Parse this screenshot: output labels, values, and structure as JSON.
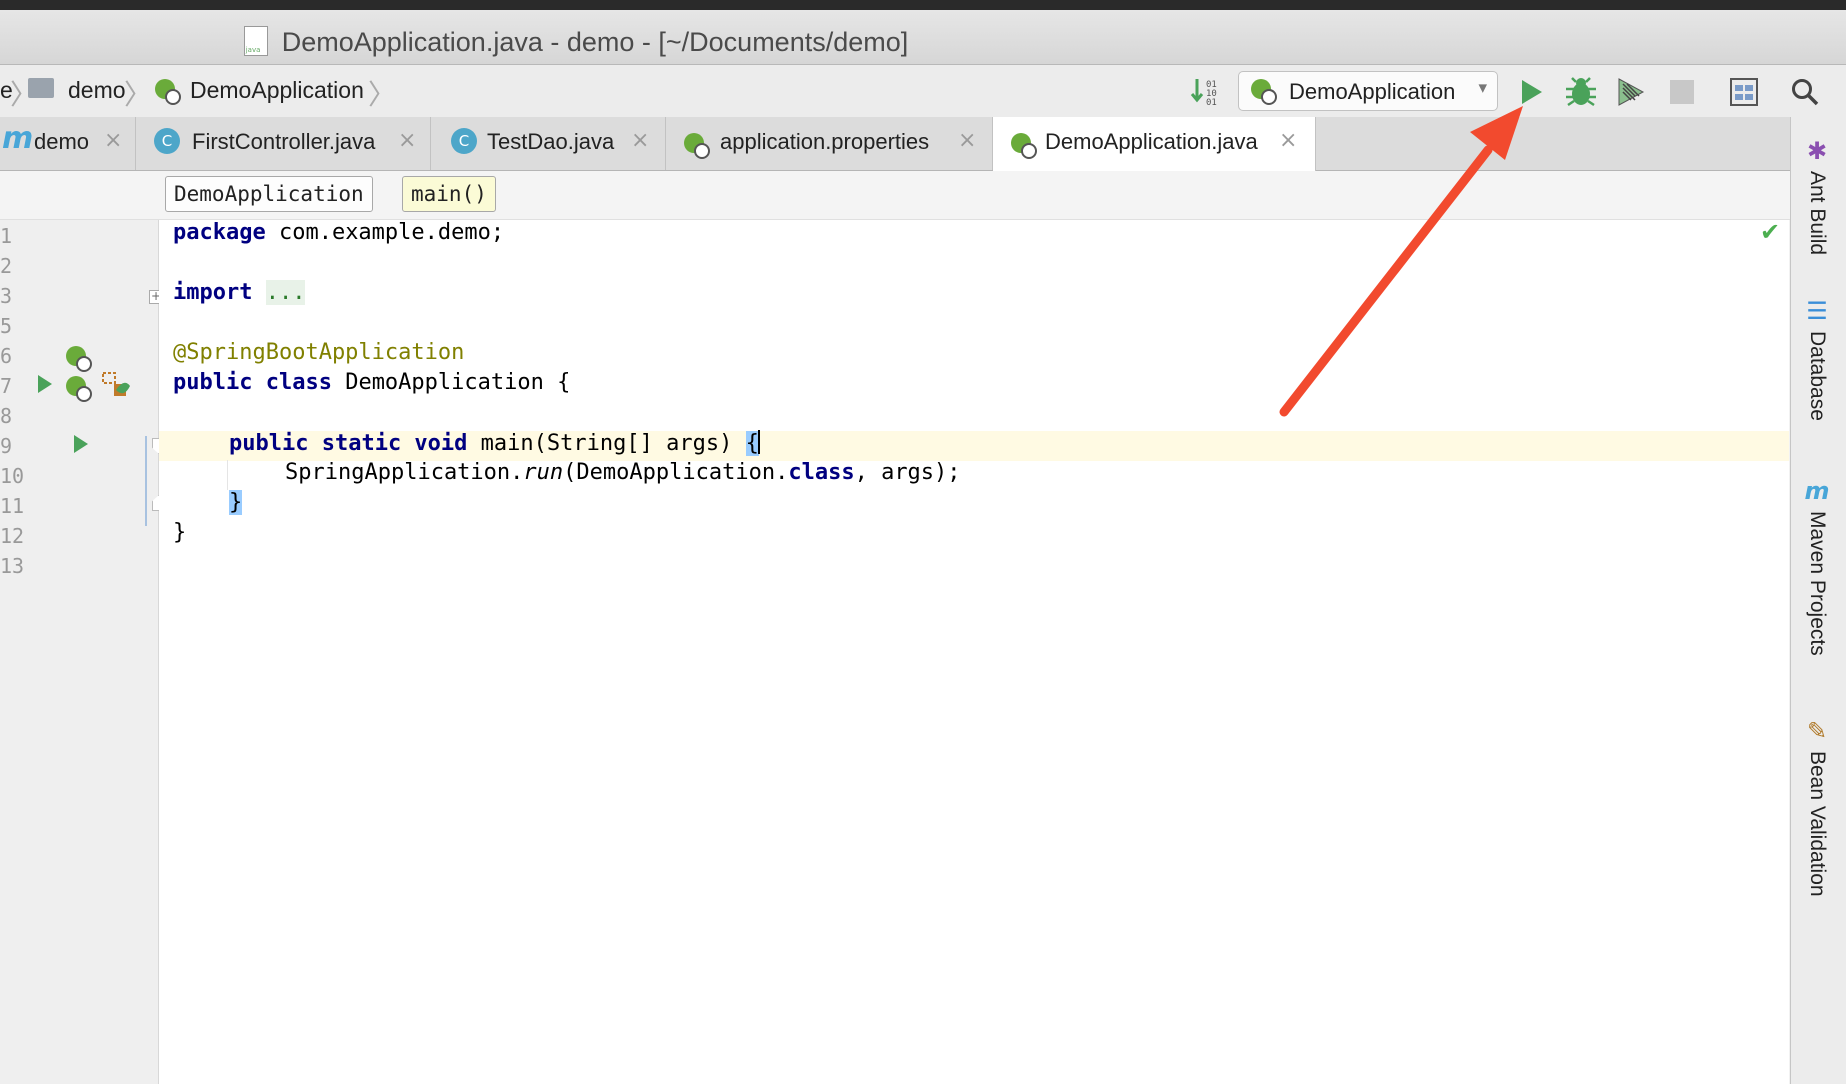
{
  "window": {
    "title": "DemoApplication.java - demo - [~/Documents/demo]"
  },
  "breadcrumb": {
    "root": "e",
    "project": "demo",
    "class": "DemoApplication"
  },
  "toolbar": {
    "run_config": "DemoApplication",
    "icons": [
      "sort-icon",
      "run-icon",
      "debug-icon",
      "coverage-icon",
      "stop-icon",
      "project-structure-icon",
      "search-icon"
    ]
  },
  "tabs": [
    {
      "label": "demo",
      "icon": "maven-m-icon"
    },
    {
      "label": "FirstController.java",
      "icon": "class-icon"
    },
    {
      "label": "TestDao.java",
      "icon": "class-icon"
    },
    {
      "label": "application.properties",
      "icon": "spring-icon"
    },
    {
      "label": "DemoApplication.java",
      "icon": "spring-icon",
      "active": true
    }
  ],
  "editor_breadcrumb": {
    "class": "DemoApplication",
    "method": "main()"
  },
  "line_numbers": [
    "1",
    "2",
    "3",
    "5",
    "6",
    "7",
    "8",
    "9",
    "10",
    "11",
    "12",
    "13"
  ],
  "code": {
    "l1_kw": "package",
    "l1_rest": " com.example.demo;",
    "l3_kw": "import",
    "l3_fold": "...",
    "l6_ann": "@SpringBootApplication",
    "l7_kw": "public class",
    "l7_rest": " DemoApplication {",
    "l9_kw": "public static void",
    "l9_rest": " main(String[] args) ",
    "l9_brace": "{",
    "l10_a": "SpringApplication.",
    "l10_run": "run",
    "l10_b": "(DemoApplication.",
    "l10_kw": "class",
    "l10_c": ", args);",
    "l11_brace": "}",
    "l12": "}"
  },
  "side_tools": [
    "Ant Build",
    "Database",
    "Maven Projects",
    "Bean Validation"
  ],
  "colors": {
    "arrow": "#f24a2e",
    "run": "#4aa25a",
    "keyword": "#000080",
    "annotation": "#808000"
  }
}
